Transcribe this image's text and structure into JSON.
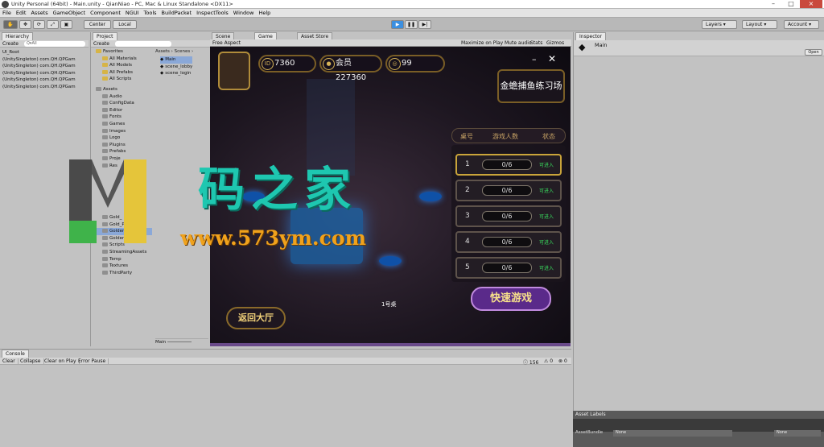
{
  "window": {
    "title": "Unity Personal (64bit) - Main.unity - QianNiao - PC, Mac & Linux Standalone <DX11>"
  },
  "menu": [
    "File",
    "Edit",
    "Assets",
    "GameObject",
    "Component",
    "NGUI",
    "Tools",
    "BuildPacket",
    "InspectTools",
    "Window",
    "Help"
  ],
  "toolbar": {
    "pivot": "Center",
    "space": "Local",
    "layers": "Layers",
    "layout": "Layout",
    "account": "Account"
  },
  "hierarchy": {
    "tab": "Hierarchy",
    "create": "Create",
    "search": "Q▾All",
    "items": [
      "UI_Root",
      "(UnitySingleton) com.QH.QPGam",
      "(UnitySingleton) com.QH.QPGam",
      "(UnitySingleton) com.QH.QPGam",
      "(UnitySingleton) com.QH.QPGam",
      "(UnitySingleton) com.QH.QPGam"
    ]
  },
  "project": {
    "tab": "Project",
    "create": "Create",
    "favorites_label": "Favorites",
    "favorites": [
      "All Materials",
      "All Models",
      "All Prefabs",
      "All Scripts"
    ],
    "assets_label": "Assets",
    "folders": [
      "Audio",
      "ConfigData",
      "Editor",
      "Fonts",
      "Games",
      "Images",
      "Logo",
      "Plugins",
      "Prefabs",
      "Proje",
      "Res"
    ],
    "lower_folders": [
      "Gold_",
      "Gold_Phone",
      "Golden_PC",
      "Golden_Phone",
      "Scripts",
      "StreamingAssets",
      "Temp",
      "Textures",
      "ThirdParty"
    ],
    "breadcrumb": [
      "Assets",
      "Scenes"
    ],
    "scenes": [
      "Main",
      "scene_lobby",
      "scene_login"
    ],
    "footer": "Main"
  },
  "scene_tabs": [
    "Scene",
    "Game",
    "Asset Store"
  ],
  "game_view": {
    "aspect": "Free Aspect",
    "buttons": [
      "Maximize on Play",
      "Mute audio",
      "Stats",
      "Gizmos"
    ]
  },
  "game": {
    "id_value": "7360",
    "member": "会员227360",
    "coins": "99",
    "room_title": "金蟾捕鱼练习场",
    "col_table": "桌号",
    "col_players": "游戏人数",
    "col_status": "状态",
    "tables": [
      {
        "num": "1",
        "count": "0/6",
        "status": "可进入"
      },
      {
        "num": "2",
        "count": "0/6",
        "status": "可进入"
      },
      {
        "num": "3",
        "count": "0/6",
        "status": "可进入"
      },
      {
        "num": "4",
        "count": "0/6",
        "status": "可进入"
      },
      {
        "num": "5",
        "count": "0/6",
        "status": "可进入"
      }
    ],
    "quick_start": "快速游戏",
    "back": "返回大厅",
    "table_label": "1号桌"
  },
  "watermark": {
    "text": "码之家",
    "url": "www.573ym.com"
  },
  "inspector": {
    "tab": "Inspector",
    "object": "Main",
    "open": "Open",
    "asset_labels": "Asset Labels",
    "asset_bundle": "AssetBundle",
    "none1": "None",
    "none2": "None"
  },
  "console": {
    "tab": "Console",
    "buttons": [
      "Clear",
      "Collapse",
      "Clear on Play",
      "Error Pause"
    ],
    "count_log": "156",
    "count_warn": "0",
    "count_err": "0"
  }
}
